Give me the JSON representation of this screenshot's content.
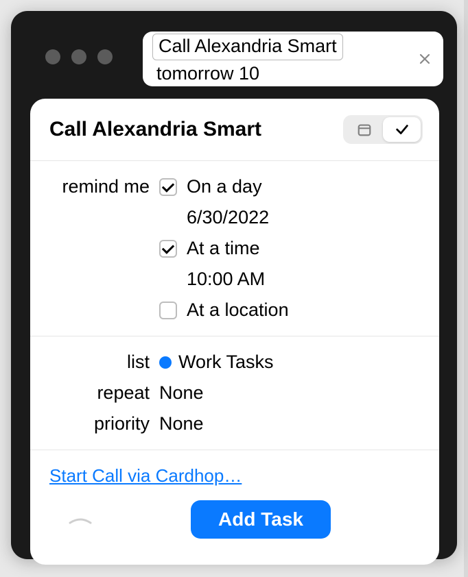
{
  "input": {
    "token": "Call Alexandria Smart",
    "rest": "tomorrow 10"
  },
  "card": {
    "title": "Call Alexandria Smart",
    "segmented": {
      "calendar_active": false,
      "task_active": true
    }
  },
  "remind": {
    "label": "remind me",
    "on_a_day": {
      "label": "On a day",
      "checked": true,
      "value": "6/30/2022"
    },
    "at_a_time": {
      "label": "At a time",
      "checked": true,
      "value": "10:00 AM"
    },
    "at_a_location": {
      "label": "At a location",
      "checked": false
    }
  },
  "details": {
    "list": {
      "label": "list",
      "value": "Work Tasks",
      "color": "#0a7aff"
    },
    "repeat": {
      "label": "repeat",
      "value": "None"
    },
    "priority": {
      "label": "priority",
      "value": "None"
    }
  },
  "link": {
    "text": "Start Call via Cardhop…"
  },
  "add_button": {
    "label": "Add Task"
  },
  "icons": {
    "close": "close-icon",
    "calendar": "calendar-icon",
    "checkmark": "checkmark-icon",
    "chevron": "chevron-up-icon"
  }
}
